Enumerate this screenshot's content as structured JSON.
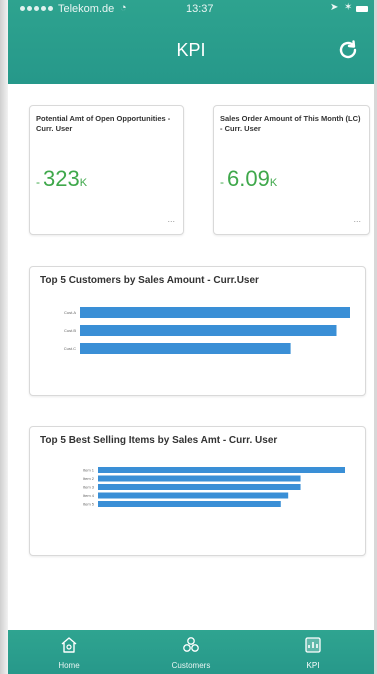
{
  "status_bar": {
    "carrier": "Telekom.de",
    "time": "13:37"
  },
  "nav": {
    "title": "KPI",
    "refresh_icon": "refresh-icon"
  },
  "kpis": [
    {
      "title": "Potential Amt of Open Opportunities - Curr. User",
      "value": "323",
      "unit": "K",
      "more": "..."
    },
    {
      "title": "Sales Order Amount of This Month (LC) - Curr. User",
      "value": "6.09",
      "unit": "K",
      "more": "..."
    }
  ],
  "chart_data": [
    {
      "type": "bar",
      "orientation": "horizontal",
      "title": "Top 5 Customers by Sales Amount - Curr.User",
      "categories": [
        "Cust.A",
        "Cust.B",
        "Cust.C"
      ],
      "values": [
        100,
        95,
        78
      ],
      "xlim": [
        0,
        100
      ],
      "color": "#3a8fd6"
    },
    {
      "type": "bar",
      "orientation": "horizontal",
      "title": "Top 5 Best Selling Items by Sales Amt - Curr. User",
      "categories": [
        "Item 1",
        "Item 2",
        "Item 3",
        "Item 4",
        "Item 5"
      ],
      "values": [
        100,
        82,
        82,
        77,
        74
      ],
      "xlim": [
        0,
        100
      ],
      "color": "#3a8fd6"
    }
  ],
  "tabs": [
    {
      "label": "Home",
      "icon": "home-icon"
    },
    {
      "label": "Customers",
      "icon": "customers-icon"
    },
    {
      "label": "KPI",
      "icon": "kpi-icon",
      "active": true
    }
  ],
  "colors": {
    "header": "#2a9d8f",
    "kpi_value": "#3fa84b",
    "bar": "#3a8fd6"
  }
}
